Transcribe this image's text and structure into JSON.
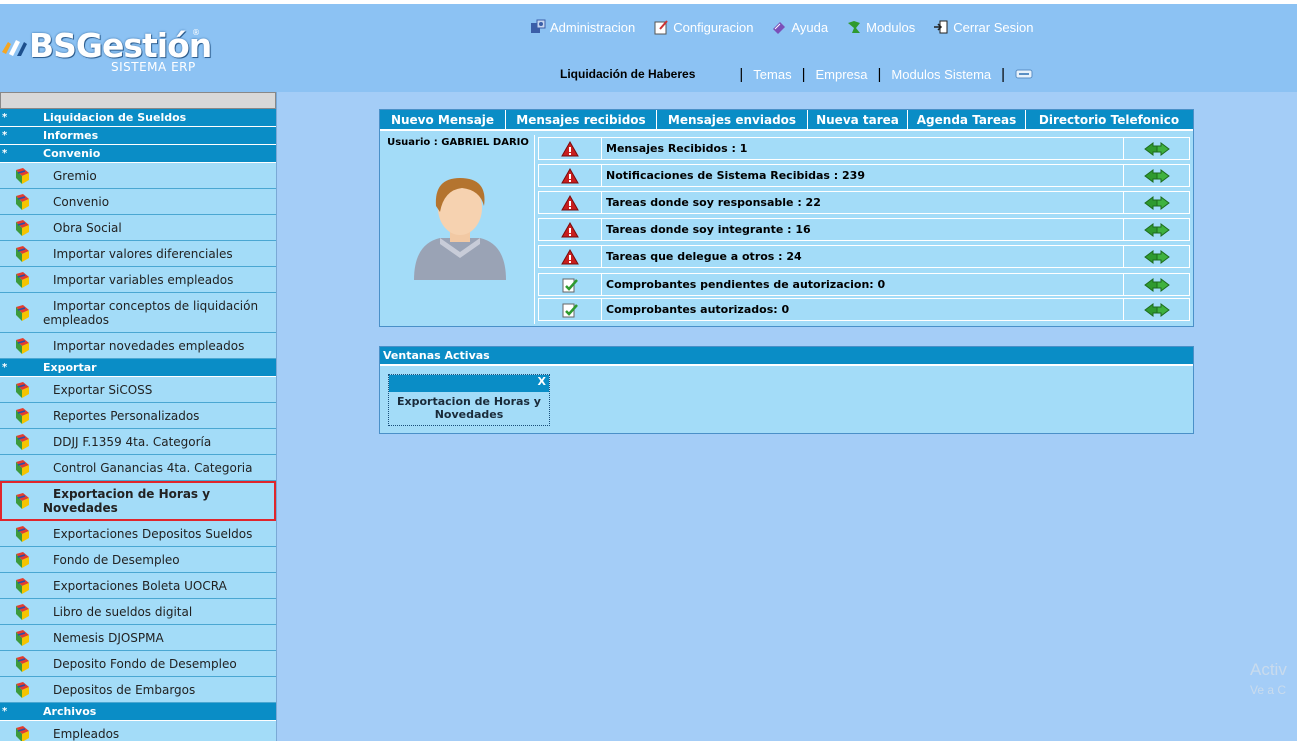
{
  "brand": {
    "name": "BSGestión",
    "registered": "®",
    "subtitle": "SISTEMA ERP"
  },
  "topnav": [
    {
      "label": "Administracion",
      "icon": "admin-icon"
    },
    {
      "label": "Configuracion",
      "icon": "config-icon"
    },
    {
      "label": "Ayuda",
      "icon": "help-icon"
    },
    {
      "label": "Modulos",
      "icon": "modules-icon"
    },
    {
      "label": "Cerrar Sesion",
      "icon": "logout-icon"
    }
  ],
  "subnav": {
    "current": "Liquidación de Haberes",
    "sep": "|",
    "temas": "Temas",
    "empresa": "Empresa",
    "modulos_sistema": "Modulos Sistema",
    "extra_icon": "keyboard-icon"
  },
  "sidebar": {
    "star": "*",
    "sections": {
      "liquidacion": "Liquidacion de Sueldos",
      "informes": "Informes",
      "convenio": "Convenio",
      "exportar": "Exportar",
      "archivos": "Archivos"
    },
    "convenio_items": [
      "Gremio",
      "Convenio",
      "Obra Social",
      "Importar valores diferenciales",
      "Importar variables empleados",
      "Importar conceptos de liquidación empleados",
      "Importar novedades empleados"
    ],
    "exportar_items": [
      "Exportar SiCOSS",
      "Reportes Personalizados",
      "DDJJ F.1359 4ta. Categoría",
      "Control Ganancias 4ta. Categoria",
      "Exportacion de Horas y Novedades",
      "Exportaciones Depositos Sueldos",
      "Fondo de Desempleo",
      "Exportaciones Boleta UOCRA",
      "Libro de sueldos digital",
      "Nemesis DJOSPMA",
      "Deposito Fondo de Desempleo",
      "Depositos de Embargos"
    ],
    "archivos_items": [
      "Empleados"
    ]
  },
  "messages": {
    "tabs": [
      "Nuevo Mensaje",
      "Mensajes recibidos",
      "Mensajes enviados",
      "Nueva tarea",
      "Agenda Tareas",
      "Directorio Telefonico"
    ],
    "user_label": "Usuario : GABRIEL DARIO",
    "rows": [
      {
        "text": "Mensajes Recibidos : 1",
        "status": "warning"
      },
      {
        "text": "Notificaciones de Sistema Recibidas : 239",
        "status": "warning"
      },
      {
        "text": "Tareas donde soy responsable : 22",
        "status": "warning"
      },
      {
        "text": "Tareas donde soy integrante : 16",
        "status": "warning"
      },
      {
        "text": "Tareas que delegue a otros : 24",
        "status": "warning"
      },
      {
        "text": "Comprobantes pendientes de autorizacion: 0",
        "status": "ok"
      },
      {
        "text": "Comprobantes autorizados: 0",
        "status": "ok"
      }
    ]
  },
  "active_windows": {
    "title": "Ventanas Activas",
    "close": "X",
    "window_title": "Exportacion de Horas y Novedades"
  },
  "watermark": {
    "line1": "Activ",
    "line2": "Ve a C"
  },
  "colors": {
    "header": "#8cc2f3",
    "section": "#0a8dc6",
    "item": "#a3dcf8",
    "selected_outline": "#e0262c",
    "page_bg": "#a4cdf7"
  }
}
